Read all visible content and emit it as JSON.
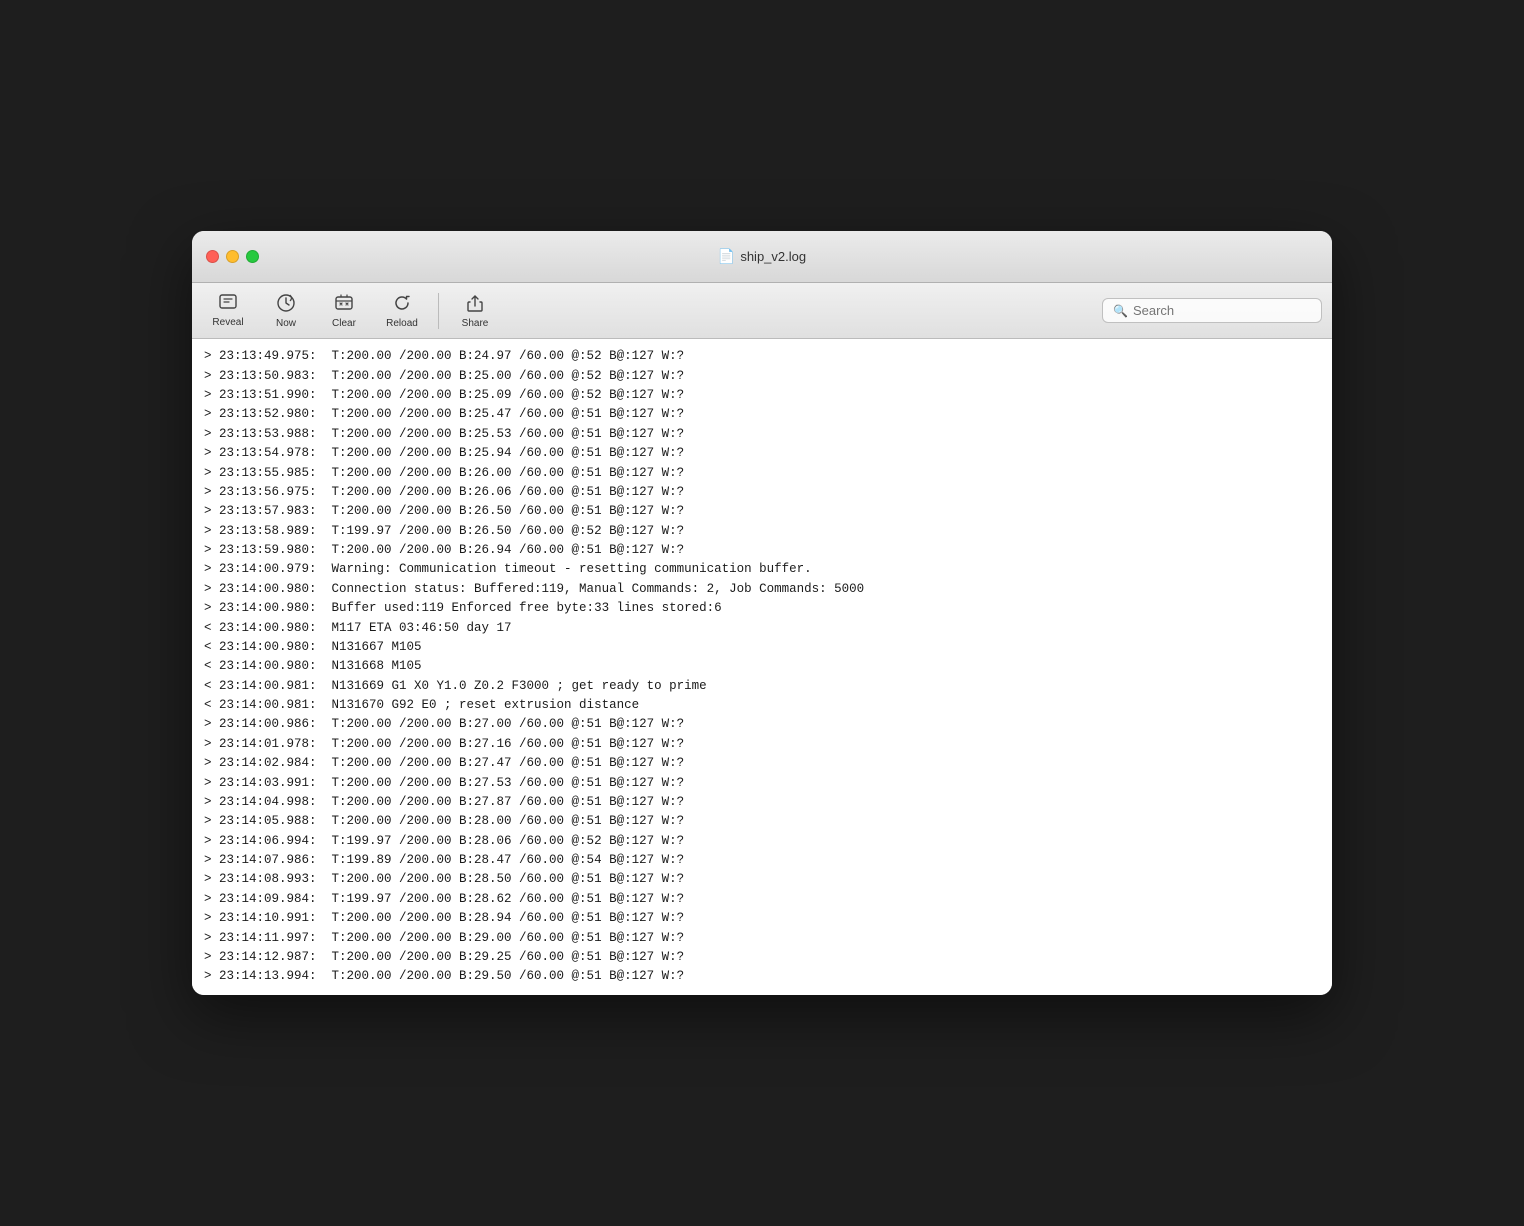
{
  "window": {
    "title": "ship_v2.log"
  },
  "toolbar": {
    "reveal_label": "Reveal",
    "now_label": "Now",
    "clear_label": "Clear",
    "reload_label": "Reload",
    "share_label": "Share",
    "search_placeholder": "Search"
  },
  "log_lines": [
    "> 23:13:49.975:  T:200.00 /200.00 B:24.97 /60.00 @:52 B@:127 W:?",
    "> 23:13:50.983:  T:200.00 /200.00 B:25.00 /60.00 @:52 B@:127 W:?",
    "> 23:13:51.990:  T:200.00 /200.00 B:25.09 /60.00 @:52 B@:127 W:?",
    "> 23:13:52.980:  T:200.00 /200.00 B:25.47 /60.00 @:51 B@:127 W:?",
    "> 23:13:53.988:  T:200.00 /200.00 B:25.53 /60.00 @:51 B@:127 W:?",
    "> 23:13:54.978:  T:200.00 /200.00 B:25.94 /60.00 @:51 B@:127 W:?",
    "> 23:13:55.985:  T:200.00 /200.00 B:26.00 /60.00 @:51 B@:127 W:?",
    "> 23:13:56.975:  T:200.00 /200.00 B:26.06 /60.00 @:51 B@:127 W:?",
    "> 23:13:57.983:  T:200.00 /200.00 B:26.50 /60.00 @:51 B@:127 W:?",
    "> 23:13:58.989:  T:199.97 /200.00 B:26.50 /60.00 @:52 B@:127 W:?",
    "> 23:13:59.980:  T:200.00 /200.00 B:26.94 /60.00 @:51 B@:127 W:?",
    "> 23:14:00.979:  Warning: Communication timeout - resetting communication buffer.",
    "> 23:14:00.980:  Connection status: Buffered:119, Manual Commands: 2, Job Commands: 5000",
    "> 23:14:00.980:  Buffer used:119 Enforced free byte:33 lines stored:6",
    "< 23:14:00.980:  M117 ETA 03:46:50 day 17",
    "< 23:14:00.980:  N131667 M105",
    "< 23:14:00.980:  N131668 M105",
    "< 23:14:00.981:  N131669 G1 X0 Y1.0 Z0.2 F3000 ; get ready to prime",
    "< 23:14:00.981:  N131670 G92 E0 ; reset extrusion distance",
    "> 23:14:00.986:  T:200.00 /200.00 B:27.00 /60.00 @:51 B@:127 W:?",
    "> 23:14:01.978:  T:200.00 /200.00 B:27.16 /60.00 @:51 B@:127 W:?",
    "> 23:14:02.984:  T:200.00 /200.00 B:27.47 /60.00 @:51 B@:127 W:?",
    "> 23:14:03.991:  T:200.00 /200.00 B:27.53 /60.00 @:51 B@:127 W:?",
    "> 23:14:04.998:  T:200.00 /200.00 B:27.87 /60.00 @:51 B@:127 W:?",
    "> 23:14:05.988:  T:200.00 /200.00 B:28.00 /60.00 @:51 B@:127 W:?",
    "> 23:14:06.994:  T:199.97 /200.00 B:28.06 /60.00 @:52 B@:127 W:?",
    "> 23:14:07.986:  T:199.89 /200.00 B:28.47 /60.00 @:54 B@:127 W:?",
    "> 23:14:08.993:  T:200.00 /200.00 B:28.50 /60.00 @:51 B@:127 W:?",
    "> 23:14:09.984:  T:199.97 /200.00 B:28.62 /60.00 @:51 B@:127 W:?",
    "> 23:14:10.991:  T:200.00 /200.00 B:28.94 /60.00 @:51 B@:127 W:?",
    "> 23:14:11.997:  T:200.00 /200.00 B:29.00 /60.00 @:51 B@:127 W:?",
    "> 23:14:12.987:  T:200.00 /200.00 B:29.25 /60.00 @:51 B@:127 W:?",
    "> 23:14:13.994:  T:200.00 /200.00 B:29.50 /60.00 @:51 B@:127 W:?"
  ]
}
